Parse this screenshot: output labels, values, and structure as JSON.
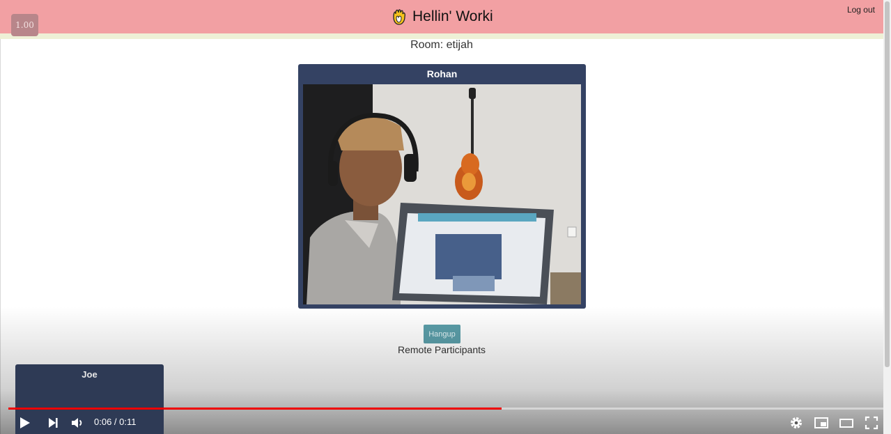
{
  "app": {
    "title": "Hellin' Worki",
    "logout_label": "Log out",
    "speed_badge": "1.00"
  },
  "room": {
    "label": "Room: etijah"
  },
  "local_video": {
    "participant_name": "Rohan"
  },
  "call": {
    "hangup_label": "Hangup",
    "remote_section_label": "Remote Participants",
    "remote_participants": [
      {
        "name": "Joe"
      }
    ]
  },
  "player": {
    "time_display": "0:06 / 0:11",
    "progress_fraction": 0.564,
    "controls": [
      "play-icon",
      "next-icon",
      "volume-icon",
      "settings-icon",
      "miniplayer-icon",
      "theater-icon",
      "fullscreen-icon"
    ]
  },
  "colors": {
    "header_bg": "#f2a0a3",
    "card_bg": "#344263",
    "hangup_bg": "#5b9ea9",
    "progress": "#ee0000"
  }
}
